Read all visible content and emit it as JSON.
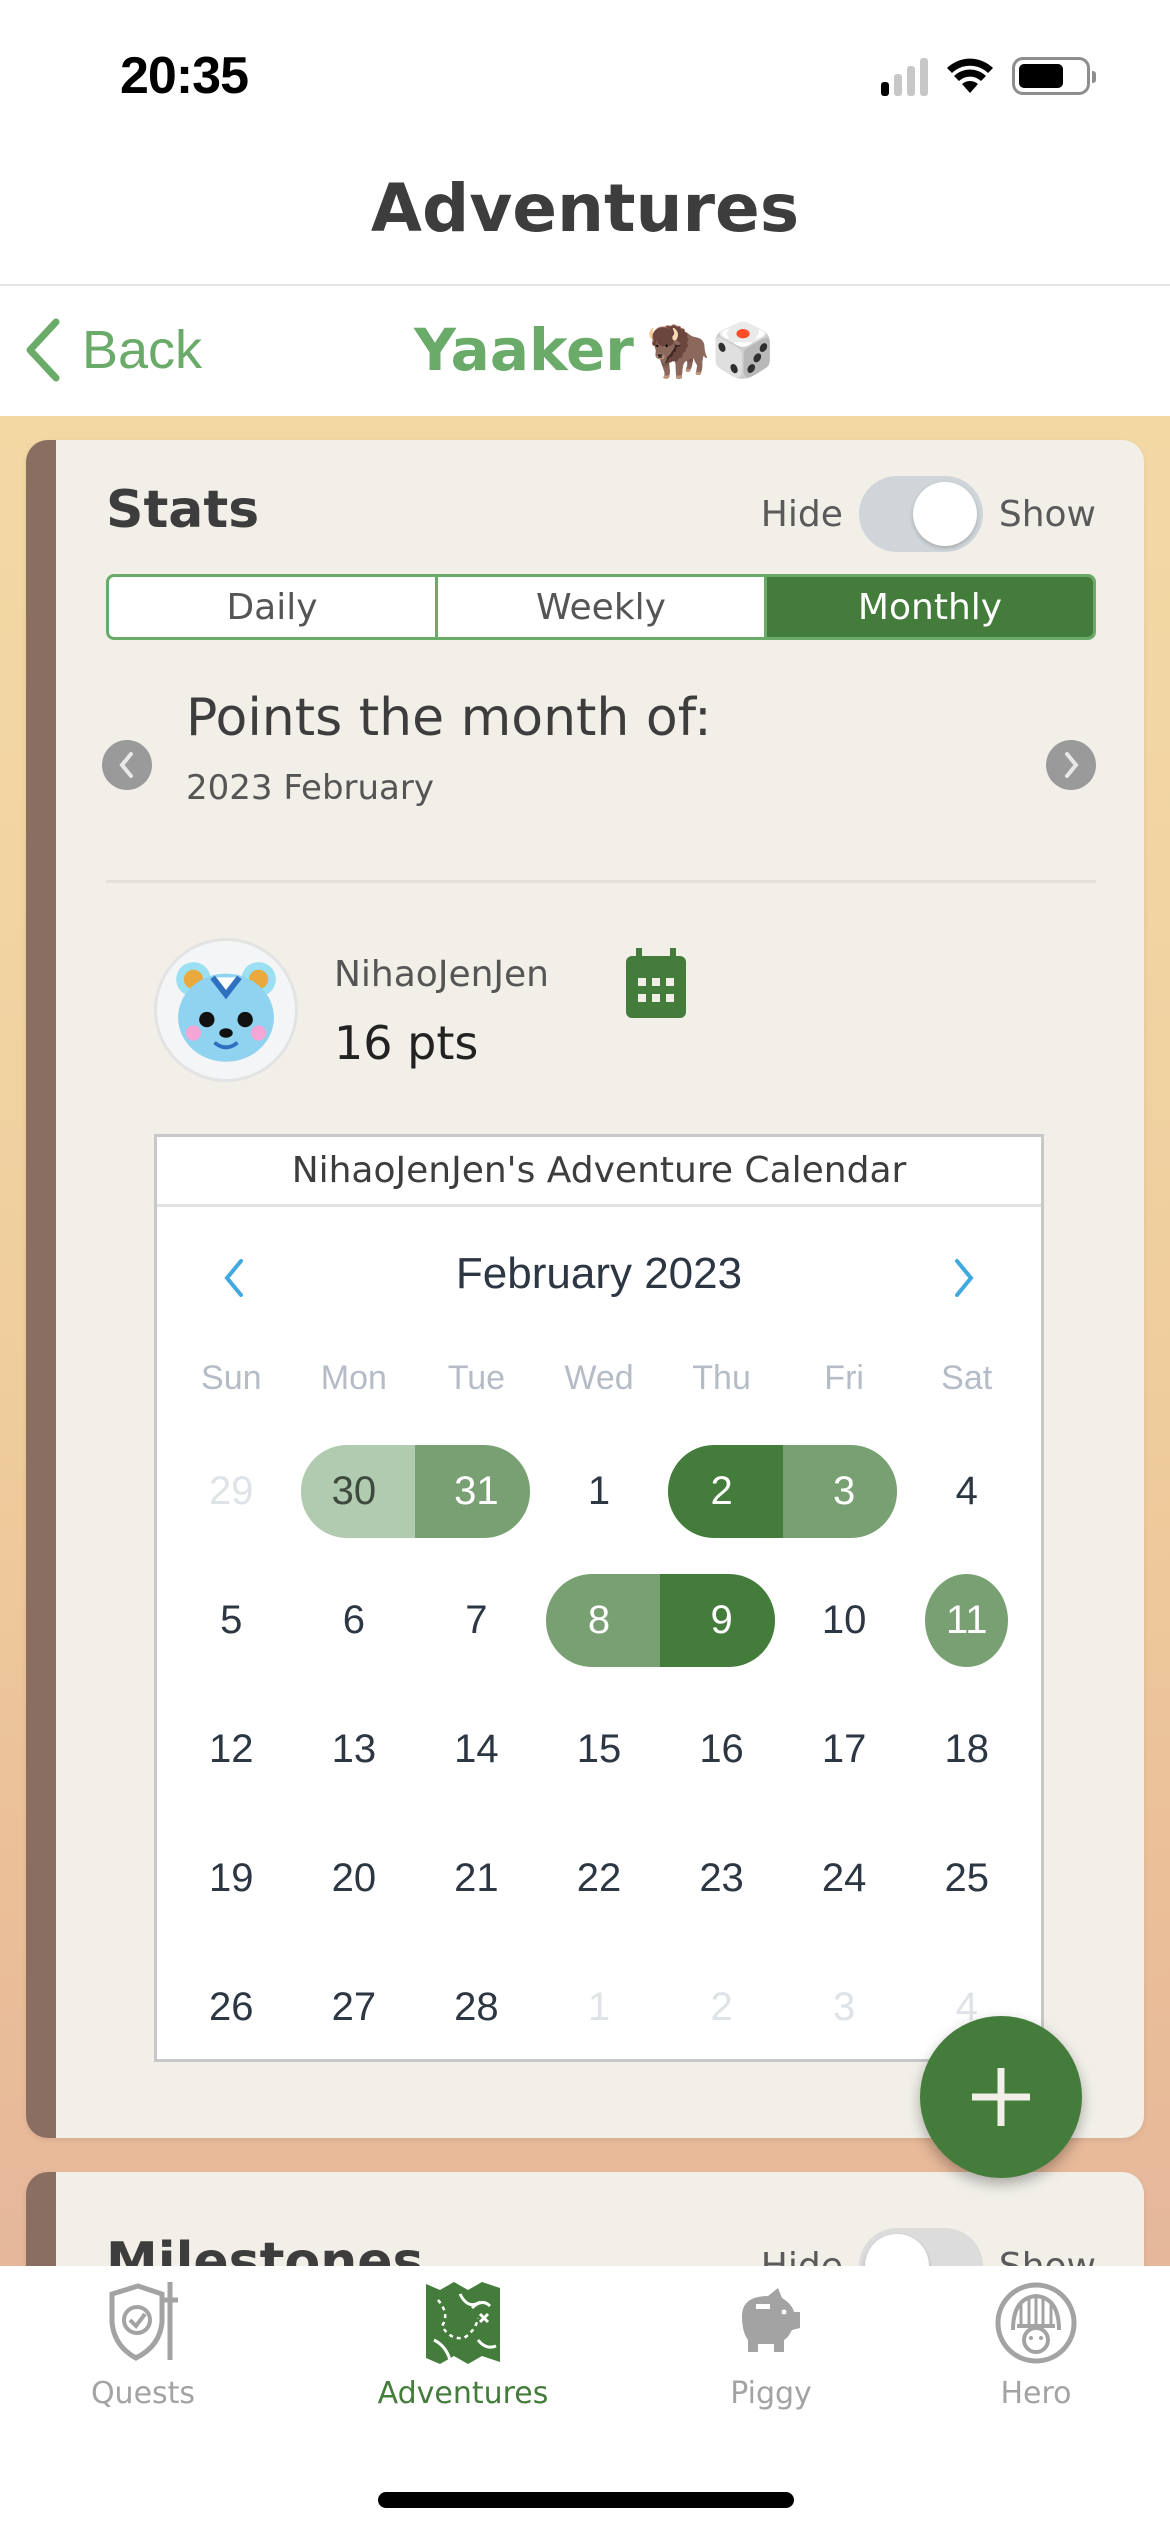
{
  "status_bar": {
    "time": "20:35",
    "signal_bars_on": 1,
    "signal_bars_total": 4,
    "battery_level": 0.68
  },
  "header": {
    "title": "Adventures"
  },
  "subnav": {
    "back_label": "Back",
    "team_name": "Yaaker",
    "team_emoji": "🦬🎲"
  },
  "colors": {
    "accent": "#447c3b",
    "accent_light": "#6aab6a",
    "spine": "#8a6e62",
    "card_bg": "#f2efe9"
  },
  "stats": {
    "title": "Stats",
    "toggle": {
      "off_label": "Hide",
      "on_label": "Show",
      "state": "show"
    },
    "tabs": [
      {
        "label": "Daily",
        "active": false
      },
      {
        "label": "Weekly",
        "active": false
      },
      {
        "label": "Monthly",
        "active": true
      }
    ],
    "period_title": "Points the month of:",
    "period_value": "2023 February",
    "user": {
      "name": "NihaoJenJen",
      "points": "16 pts",
      "avatar_icon": "bear-avatar"
    },
    "calendar": {
      "title": "NihaoJenJen's Adventure Calendar",
      "month_label": "February 2023",
      "weekdays": [
        "Sun",
        "Mon",
        "Tue",
        "Wed",
        "Thu",
        "Fri",
        "Sat"
      ],
      "days": [
        {
          "n": "29",
          "outside": true
        },
        {
          "n": "30",
          "level": 1,
          "seg": "start"
        },
        {
          "n": "31",
          "level": 2,
          "seg": "end"
        },
        {
          "n": "1"
        },
        {
          "n": "2",
          "level": 3,
          "seg": "start"
        },
        {
          "n": "3",
          "level": 2,
          "seg": "end"
        },
        {
          "n": "4"
        },
        {
          "n": "5"
        },
        {
          "n": "6"
        },
        {
          "n": "7"
        },
        {
          "n": "8",
          "level": 2,
          "seg": "start"
        },
        {
          "n": "9",
          "level": 3,
          "seg": "end"
        },
        {
          "n": "10"
        },
        {
          "n": "11",
          "level": 2,
          "seg": "single"
        },
        {
          "n": "12"
        },
        {
          "n": "13"
        },
        {
          "n": "14"
        },
        {
          "n": "15"
        },
        {
          "n": "16"
        },
        {
          "n": "17"
        },
        {
          "n": "18"
        },
        {
          "n": "19"
        },
        {
          "n": "20"
        },
        {
          "n": "21"
        },
        {
          "n": "22"
        },
        {
          "n": "23"
        },
        {
          "n": "24"
        },
        {
          "n": "25"
        },
        {
          "n": "26"
        },
        {
          "n": "27"
        },
        {
          "n": "28"
        },
        {
          "n": "1",
          "outside": true
        },
        {
          "n": "2",
          "outside": true
        },
        {
          "n": "3",
          "outside": true
        },
        {
          "n": "4",
          "outside": true
        }
      ],
      "level_colors": {
        "1": "#b1cbb0",
        "2": "#79a072",
        "3": "#447c3b"
      }
    }
  },
  "milestones": {
    "title": "Milestones",
    "toggle": {
      "off_label": "Hide",
      "on_label": "Show",
      "state": "hide"
    }
  },
  "fab": {
    "icon": "plus-icon"
  },
  "tab_bar": [
    {
      "label": "Quests",
      "icon": "shield-sword-icon",
      "active": false
    },
    {
      "label": "Adventures",
      "icon": "treasure-map-icon",
      "active": true
    },
    {
      "label": "Piggy",
      "icon": "piggy-bank-icon",
      "active": false
    },
    {
      "label": "Hero",
      "icon": "knight-helmet-icon",
      "active": false
    }
  ]
}
